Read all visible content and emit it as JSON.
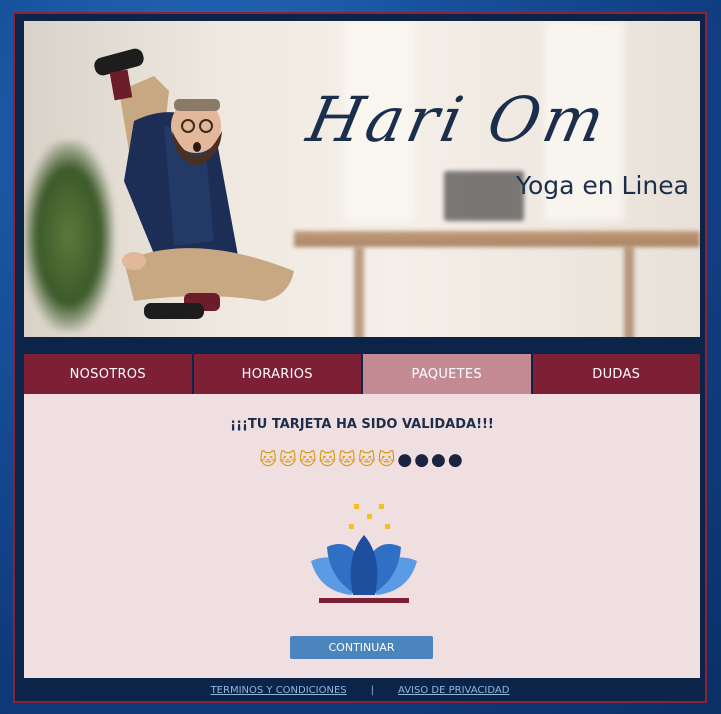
{
  "hero": {
    "logo_title": "Hari Om",
    "logo_subtitle": "Yoga en Linea"
  },
  "nav": {
    "tabs": [
      {
        "label": "NOSOTROS",
        "active": false
      },
      {
        "label": "HORARIOS",
        "active": false
      },
      {
        "label": "PAQUETES",
        "active": true
      },
      {
        "label": "DUDAS",
        "active": false
      }
    ]
  },
  "content": {
    "message": "¡¡¡TU TARJETA HA SIDO VALIDADA!!!",
    "emoji_cats": "🐱🐱🐱🐱🐱🐱🐱",
    "emoji_dark": "●●●●",
    "continue_label": "CONTINUAR"
  },
  "footer": {
    "terms_label": "TERMINOS Y CONDICIONES",
    "separator": "|",
    "privacy_label": "AVISO DE PRIVACIDAD"
  },
  "colors": {
    "navy": "#0b2447",
    "maroon": "#7d1f35",
    "active_tab": "#c48a93",
    "content_bg": "#efdfe1",
    "button": "#4a86bd",
    "lotus_blue": "#4a86d6",
    "lotus_gold": "#f4c21a"
  }
}
